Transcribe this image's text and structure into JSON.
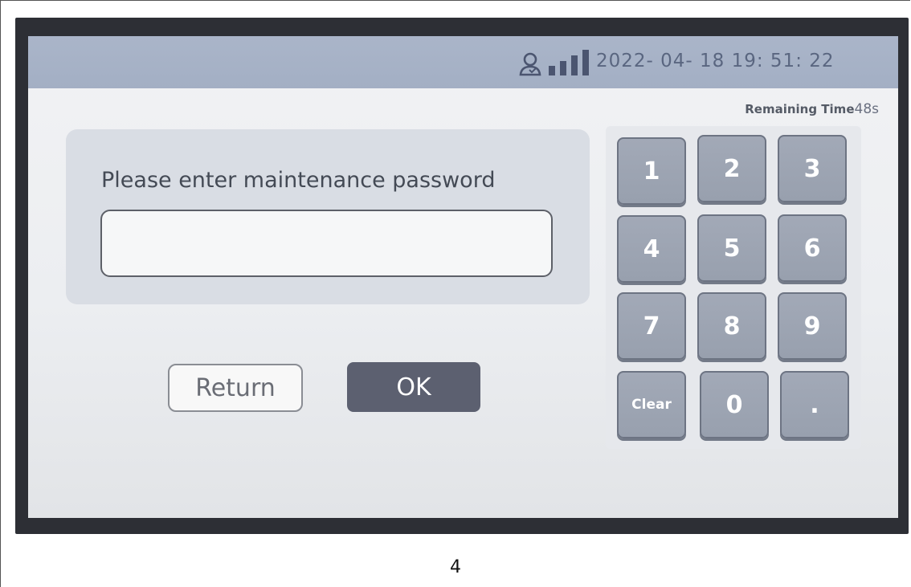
{
  "status_bar": {
    "datetime": "2022- 04- 18  19: 51: 22",
    "icons": [
      "user-icon",
      "signal-bars-icon"
    ]
  },
  "remaining_time": {
    "label": "Remaining Time",
    "seconds": "48s"
  },
  "password_panel": {
    "prompt": "Please enter maintenance password",
    "field_value": ""
  },
  "actions": {
    "return_label": "Return",
    "ok_label": "OK"
  },
  "keypad": {
    "keys": [
      "1",
      "2",
      "3",
      "4",
      "5",
      "6",
      "7",
      "8",
      "9",
      "Clear",
      "0",
      "."
    ]
  },
  "colors": {
    "status_bar": "#a7b2c6",
    "key": "#9ea5b3",
    "ok_button": "#5c6070"
  },
  "page_number": "4"
}
